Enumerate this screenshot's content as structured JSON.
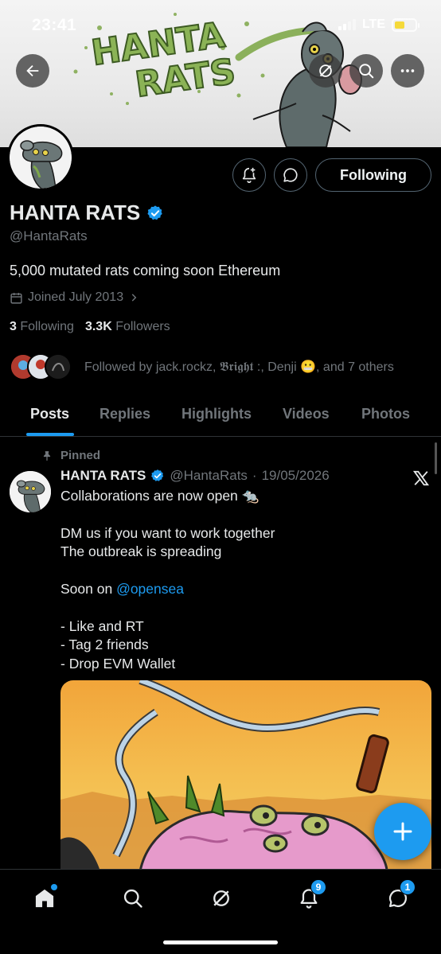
{
  "status_bar": {
    "time": "23:41",
    "network": "LTE"
  },
  "banner": {
    "art_text_line1": "HANTA",
    "art_text_line2": "RATS"
  },
  "profile": {
    "display_name": "HANTA RATS",
    "handle": "@HantaRats",
    "bio": "5,000 mutated rats coming soon Ethereum",
    "joined": "Joined July 2013",
    "following_count": "3",
    "following_label": "Following",
    "followers_count": "3.3K",
    "followers_label": "Followers",
    "followed_by_text": "Followed by jack.rockz, 𝕭𝖗𝖎𝖌𝖍𝖙 :, Denji 😬, and 7 others",
    "follow_button_label": "Following"
  },
  "tabs": [
    {
      "label": "Posts",
      "active": true
    },
    {
      "label": "Replies"
    },
    {
      "label": "Highlights"
    },
    {
      "label": "Videos"
    },
    {
      "label": "Photos"
    }
  ],
  "post": {
    "pinned_label": "Pinned",
    "author_name": "HANTA RATS",
    "author_handle": "@HantaRats",
    "date": "19/05/2026",
    "lines": [
      "Collaborations are now open 🐀",
      "",
      "DM us if you want to work together",
      "The outbreak is spreading",
      "",
      "Soon on ",
      "",
      "- Like and RT",
      "- Tag 2 friends",
      "- Drop EVM Wallet"
    ],
    "mention": "@opensea"
  },
  "bottom_nav": {
    "notifications_badge": "9",
    "messages_badge": "1"
  },
  "colors": {
    "accent": "#1d9bf0",
    "background": "#000000",
    "text": "#e7e9ea",
    "muted": "#71767b",
    "slime": "#7fa84a"
  },
  "icons": [
    "back-arrow-icon",
    "grok-icon",
    "search-icon",
    "more-icon",
    "add-notification-icon",
    "chat-icon",
    "verified-badge-icon",
    "calendar-icon",
    "chevron-right-icon",
    "pin-icon",
    "x-logo-icon",
    "plus-icon",
    "home-icon",
    "explore-icon",
    "grok-icon",
    "bell-icon",
    "messages-icon"
  ]
}
